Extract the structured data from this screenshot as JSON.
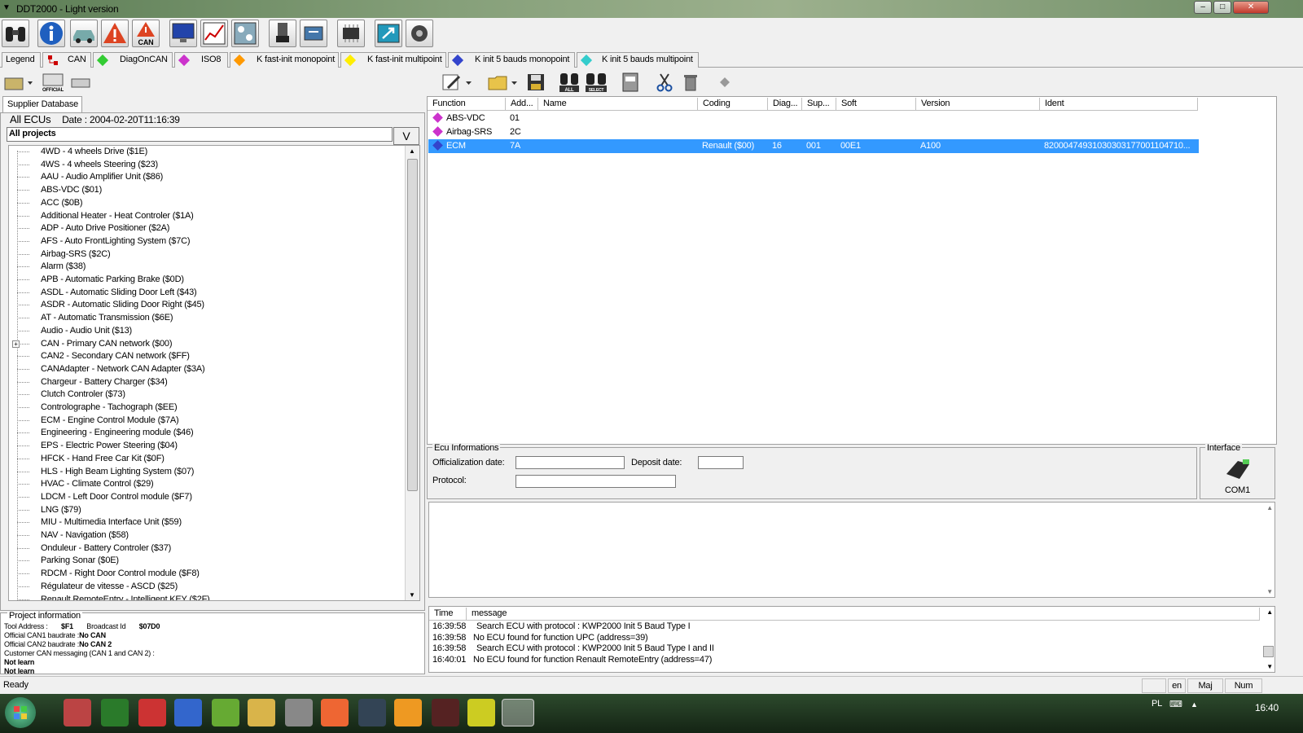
{
  "window": {
    "title": "DDT2000 - Light version"
  },
  "protocol_tabs": [
    {
      "label": "Legend",
      "color": ""
    },
    {
      "label": "CAN",
      "color": "#c00000"
    },
    {
      "label": "DiagOnCAN",
      "color": "#33cc33"
    },
    {
      "label": "ISO8",
      "color": "#cc33cc"
    },
    {
      "label": "K fast-init monopoint",
      "color": "#ff9900"
    },
    {
      "label": "K fast-init multipoint",
      "color": "#ffee00"
    },
    {
      "label": "K init 5 bauds monopoint",
      "color": "#3344cc"
    },
    {
      "label": "K init 5 bauds multipoint",
      "color": "#33cccc"
    }
  ],
  "toolbar2": {
    "official_label": "OFFICIAL",
    "all_label": "ALL",
    "select_label": "SELECT"
  },
  "toolbar1": {
    "can_label": "CAN"
  },
  "left": {
    "tab_label": "Supplier Database",
    "heading": "All ECUs",
    "date": "Date : 2004-02-20T11:16:39",
    "project_selected": "All projects",
    "dropdown_glyph": "V",
    "tree": [
      "4WD - 4 wheels Drive ($1E)",
      "4WS - 4 wheels Steering ($23)",
      "AAU - Audio Amplifier Unit ($86)",
      "ABS-VDC ($01)",
      "ACC ($0B)",
      "Additional Heater - Heat Controler ($1A)",
      "ADP - Auto Drive Positioner ($2A)",
      "AFS - Auto FrontLighting System ($7C)",
      "Airbag-SRS ($2C)",
      "Alarm ($38)",
      "APB - Automatic Parking Brake ($0D)",
      "ASDL - Automatic Sliding Door Left ($43)",
      "ASDR - Automatic Sliding Door Right ($45)",
      "AT - Automatic Transmission ($6E)",
      "Audio - Audio Unit ($13)",
      "CAN - Primary CAN network ($00)",
      "CAN2 - Secondary CAN network ($FF)",
      "CANAdapter - Network CAN Adapter ($3A)",
      "Chargeur - Battery Charger ($34)",
      "Clutch Controler ($73)",
      "Controlographe - Tachograph ($EE)",
      "ECM - Engine Control Module ($7A)",
      "Engineering - Engineering module ($46)",
      "EPS - Electric Power Steering ($04)",
      "HFCK - Hand Free Car Kit ($0F)",
      "HLS - High Beam Lighting System ($07)",
      "HVAC - Climate Control ($29)",
      "LDCM - Left Door Control module ($F7)",
      "LNG ($79)",
      "MIU - Multimedia Interface Unit ($59)",
      "NAV - Navigation ($58)",
      "Onduleur - Battery Controler ($37)",
      "Parking Sonar ($0E)",
      "RDCM - Right Door Control module ($F8)",
      "Régulateur de vitesse - ASCD ($25)",
      "Renault RemoteEntry - Intelligent KEY ($2F)"
    ],
    "expandable_index": 15
  },
  "project_info": {
    "title": "Project information",
    "tool_address_label": "Tool Address :",
    "tool_address": "$F1",
    "broadcast_label": "Broadcast Id",
    "broadcast": "$07D0",
    "can1_label": "Official CAN1 baudrate :",
    "can1": "No CAN",
    "can2_label": "Official CAN2 baudrate :",
    "can2": "No CAN 2",
    "customer_label": "Customer CAN messaging (CAN 1 and CAN 2) :",
    "learn1": "Not learn",
    "learn2": "Not learn"
  },
  "ecu_table": {
    "headers": [
      "Function",
      "Add...",
      "Name",
      "Coding",
      "Diag...",
      "Sup...",
      "Soft",
      "Version",
      "Ident"
    ],
    "rows": [
      {
        "function": "ABS-VDC",
        "addr": "01",
        "name": "",
        "coding": "",
        "diag": "",
        "sup": "",
        "soft": "",
        "version": "",
        "ident": "",
        "color": "#cc33cc",
        "selected": false
      },
      {
        "function": "Airbag-SRS",
        "addr": "2C",
        "name": "",
        "coding": "",
        "diag": "",
        "sup": "",
        "soft": "",
        "version": "",
        "ident": "",
        "color": "#cc33cc",
        "selected": false
      },
      {
        "function": "ECM",
        "addr": "7A",
        "name": "",
        "coding": "Renault ($00)",
        "diag": "16",
        "sup": "001",
        "soft": "00E1",
        "version": "A100",
        "ident": "82000474931030303177001104710...",
        "color": "#3344cc",
        "selected": true
      }
    ]
  },
  "ecu_info": {
    "title": "Ecu Informations",
    "official_label": "Officialization date:",
    "deposit_label": "Deposit date:",
    "protocol_label": "Protocol:"
  },
  "interface": {
    "title": "Interface",
    "port": "COM1"
  },
  "log": {
    "headers": [
      "Time",
      "message"
    ],
    "rows": [
      {
        "time": "16:39:58",
        "msg": "Search ECU with protocol : KWP2000 Init 5 Baud Type I"
      },
      {
        "time": "16:39:58",
        "msg": "No ECU found for function UPC (address=39)"
      },
      {
        "time": "16:39:58",
        "msg": "Search ECU with protocol : KWP2000 Init 5 Baud Type I and II"
      },
      {
        "time": "16:40:01",
        "msg": "No ECU found for function Renault RemoteEntry (address=47)"
      }
    ]
  },
  "status": {
    "text": "Ready",
    "lang": "en",
    "maj": "Maj",
    "num": "Num"
  },
  "taskbar": {
    "lang": "PL",
    "clock": "16:40"
  }
}
